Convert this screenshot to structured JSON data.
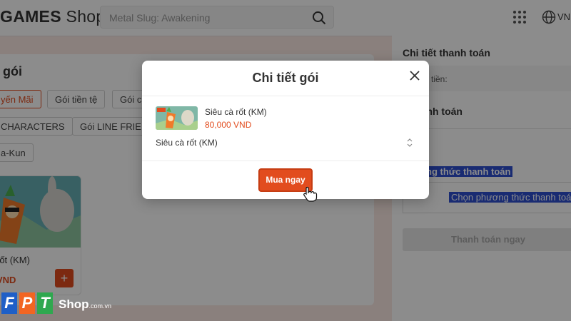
{
  "header": {
    "logo_text": "GAMES",
    "logo_text2": "Shop",
    "search_placeholder": "Metal Slug: Awakening",
    "language": "VN"
  },
  "left": {
    "title": "gói",
    "chips": [
      "yến Mãi",
      "Gói tiền tệ",
      "Gói c",
      "CHARACTERS",
      "Gói LINE FRIEN",
      "a-Kun"
    ],
    "product": {
      "name": "rốt (KM)",
      "price": "VND",
      "add_label": "+"
    }
  },
  "right_panel": {
    "payment_title": "Chi tiết thanh toán",
    "amount_label": "g tiền:",
    "section2_title": "g thanh toán",
    "method_label": "ng thức thanh toán",
    "method_select": "Chọn phương thức thanh toán",
    "pay_button": "Thanh toán ngay"
  },
  "modal": {
    "title": "Chi tiết gói",
    "item_name": "Siêu cà rốt (KM)",
    "item_price": "80,000 VND",
    "select_value": "Siêu cà rốt (KM)",
    "buy_button": "Mua ngay"
  },
  "footer": {
    "brand_letters": [
      "F",
      "P",
      "T"
    ],
    "brand_shop": "Shop",
    "brand_domain": ".com.vn"
  },
  "colors": {
    "accent": "#e24c1e",
    "selection": "#2f4fd0",
    "fpt_blue": "#1f5fc7",
    "fpt_orange": "#f26522",
    "fpt_green": "#2fa84f"
  }
}
